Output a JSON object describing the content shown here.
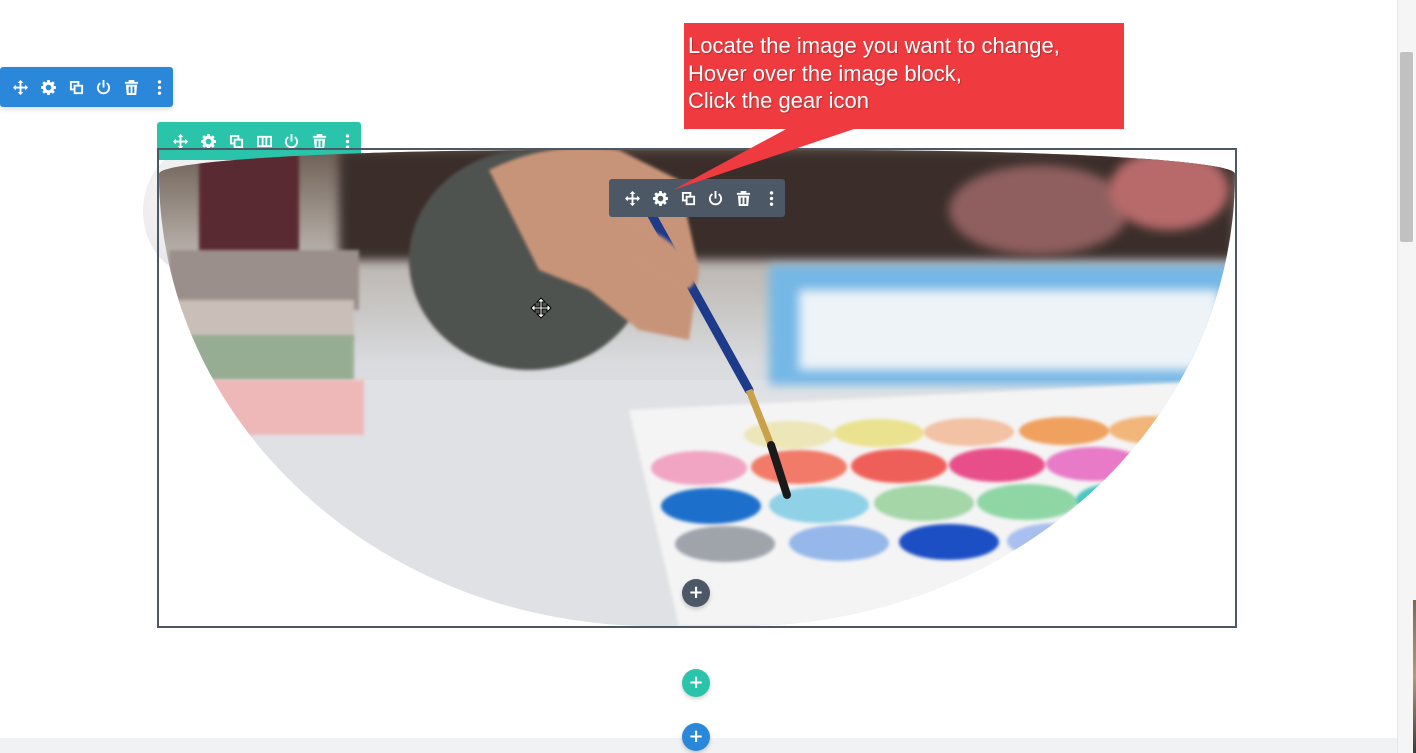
{
  "callout": {
    "lines": [
      "Locate the image you want to change,",
      "Hover over the image block,",
      "Click the gear icon"
    ],
    "background": "#ef3b3f"
  },
  "toolbars": {
    "section": {
      "color": "#2b87da",
      "icons": [
        "move-icon",
        "gear-icon",
        "duplicate-icon",
        "power-icon",
        "trash-icon",
        "more-icon"
      ]
    },
    "row": {
      "color": "#29c4a9",
      "icons": [
        "move-icon",
        "gear-icon",
        "duplicate-icon",
        "columns-icon",
        "power-icon",
        "trash-icon",
        "more-icon"
      ]
    },
    "module": {
      "color": "#4c5866",
      "icons": [
        "move-icon",
        "gear-icon",
        "duplicate-icon",
        "power-icon",
        "trash-icon",
        "more-icon"
      ]
    }
  },
  "buttons": {
    "add_module": "+",
    "add_row": "+",
    "add_section": "+"
  },
  "image": {
    "subject": "watercolor-painting-photo"
  }
}
